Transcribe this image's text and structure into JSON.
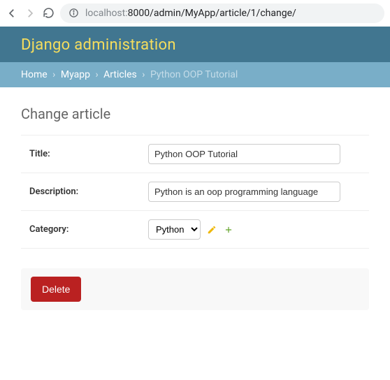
{
  "browser": {
    "url_host": "localhost:",
    "url_path": "8000/admin/MyApp/article/1/change/"
  },
  "header": {
    "title": "Django administration"
  },
  "breadcrumbs": {
    "home": "Home",
    "app": "Myapp",
    "model": "Articles",
    "current": "Python OOP Tutorial",
    "sep": "›"
  },
  "page": {
    "title": "Change article"
  },
  "form": {
    "title_label": "Title:",
    "title_value": "Python OOP Tutorial",
    "description_label": "Description:",
    "description_value": "Python is an oop programming language",
    "category_label": "Category:",
    "category_value": "Python"
  },
  "actions": {
    "delete": "Delete"
  }
}
